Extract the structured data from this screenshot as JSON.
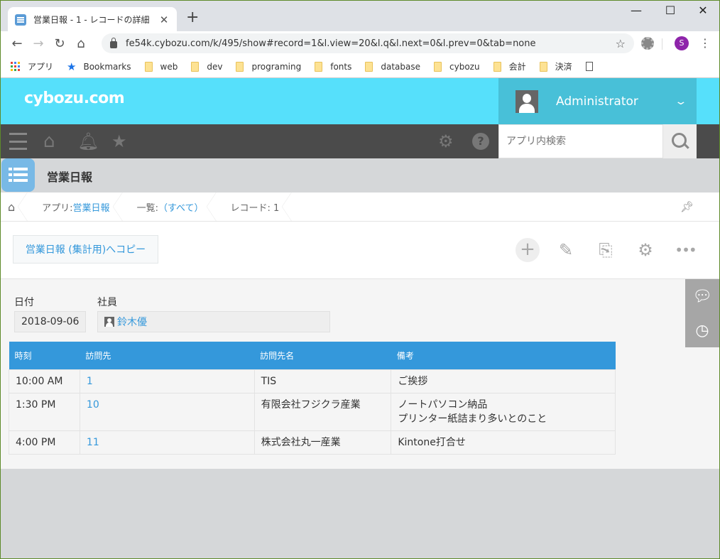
{
  "browser": {
    "tab_title": "営業日報 - 1 - レコードの詳細",
    "url": "fe54k.cybozu.com/k/495/show#record=1&l.view=20&l.q&l.next=0&l.prev=0&tab=none",
    "profile_initial": "S",
    "bookmarks": [
      {
        "label": "アプリ",
        "icon": "apps-grid-icon"
      },
      {
        "label": "Bookmarks",
        "icon": "star-icon"
      },
      {
        "label": "web",
        "icon": "folder-icon"
      },
      {
        "label": "dev",
        "icon": "folder-icon"
      },
      {
        "label": "programing",
        "icon": "folder-icon"
      },
      {
        "label": "fonts",
        "icon": "folder-icon"
      },
      {
        "label": "database",
        "icon": "folder-icon"
      },
      {
        "label": "cybozu",
        "icon": "folder-icon"
      },
      {
        "label": "会計",
        "icon": "folder-icon"
      },
      {
        "label": "決済",
        "icon": "folder-icon"
      }
    ]
  },
  "header": {
    "logo": "cybozu.com",
    "user_name": "Administrator",
    "search_placeholder": "アプリ内検索"
  },
  "app": {
    "title": "営業日報"
  },
  "breadcrumb": {
    "app_prefix": "アプリ: ",
    "app_name": "営業日報",
    "view_prefix": "一覧: ",
    "view_name": "（すべて）",
    "record": "レコード: 1"
  },
  "actions": {
    "copy_button": "営業日報 (集計用)へコピー"
  },
  "record": {
    "date_label": "日付",
    "date_value": "2018-09-06",
    "employee_label": "社員",
    "employee_value": "鈴木優",
    "table": {
      "headers": [
        "時刻",
        "訪問先",
        "訪問先名",
        "備考"
      ],
      "rows": [
        {
          "time": "10:00 AM",
          "visit_id": "1",
          "visit_name": "TIS",
          "note_1": "ご挨拶",
          "note_2": ""
        },
        {
          "time": "1:30 PM",
          "visit_id": "10",
          "visit_name": "有限会社フジクラ産業",
          "note_1": "ノートパソコン納品",
          "note_2": "プリンター紙詰まり多いとのこと"
        },
        {
          "time": "4:00 PM",
          "visit_id": "11",
          "visit_name": "株式会社丸一産業",
          "note_1": "Kintone打合せ",
          "note_2": ""
        }
      ]
    }
  },
  "colors": {
    "header_bg": "#56e0fb",
    "accent": "#3498db",
    "nav_bg": "#4b4b4b"
  }
}
